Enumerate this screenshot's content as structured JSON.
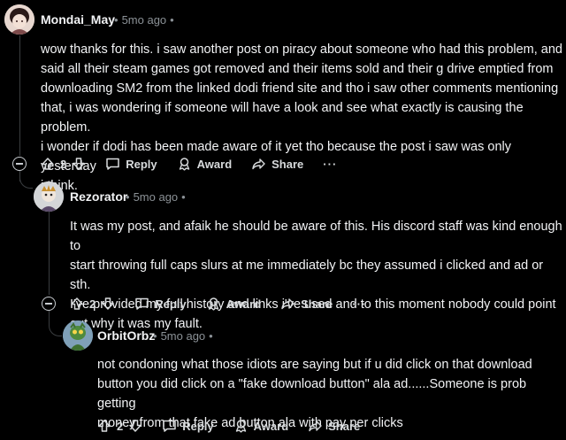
{
  "comments": [
    {
      "username": "Mondai_May",
      "time": "5mo ago",
      "body": [
        "wow thanks for this. i saw another post on piracy about someone who had this problem, and",
        "said all their steam games got removed and their items sold and their g drive emptied from",
        "downloading SM2 from the linked dodi friend site and tho i saw other comments mentioning",
        "that, i was wondering if someone will have a look and see what exactly is causing the problem.",
        "i wonder if dodi has been made aware of it yet tho because the post i saw was only yesterday",
        "i think."
      ],
      "votes": "2",
      "reply": "Reply",
      "award": "Award",
      "share": "Share",
      "more": "···"
    },
    {
      "username": "Rezorator",
      "time": "5mo ago",
      "body": [
        "It was my post, and afaik he should be aware of this. His discord staff was kind enough to",
        "start throwing full caps slurs at me immediately bc they assumed i clicked and ad or sth.",
        "I've provided my full history and links i've used and to this moment nobody could point",
        "out why it was my fault."
      ],
      "votes": "2",
      "reply": "Reply",
      "award": "Award",
      "share": "Share",
      "more": "···"
    },
    {
      "username": "OrbitOrbz",
      "time": "5mo ago",
      "body": [
        "not condoning what those idiots are saying but if u did click on that download",
        "button you did click on a \"fake download button\" ala ad......Someone is prob getting",
        "money from that fake ad button ala with pay per clicks"
      ],
      "votes": "2",
      "reply": "Reply",
      "award": "Award",
      "share": "Share"
    }
  ],
  "colors": {
    "background": "#000000",
    "text": "#f2f3f5",
    "meta": "#8b9196",
    "thread_line": "#3a3d40"
  }
}
